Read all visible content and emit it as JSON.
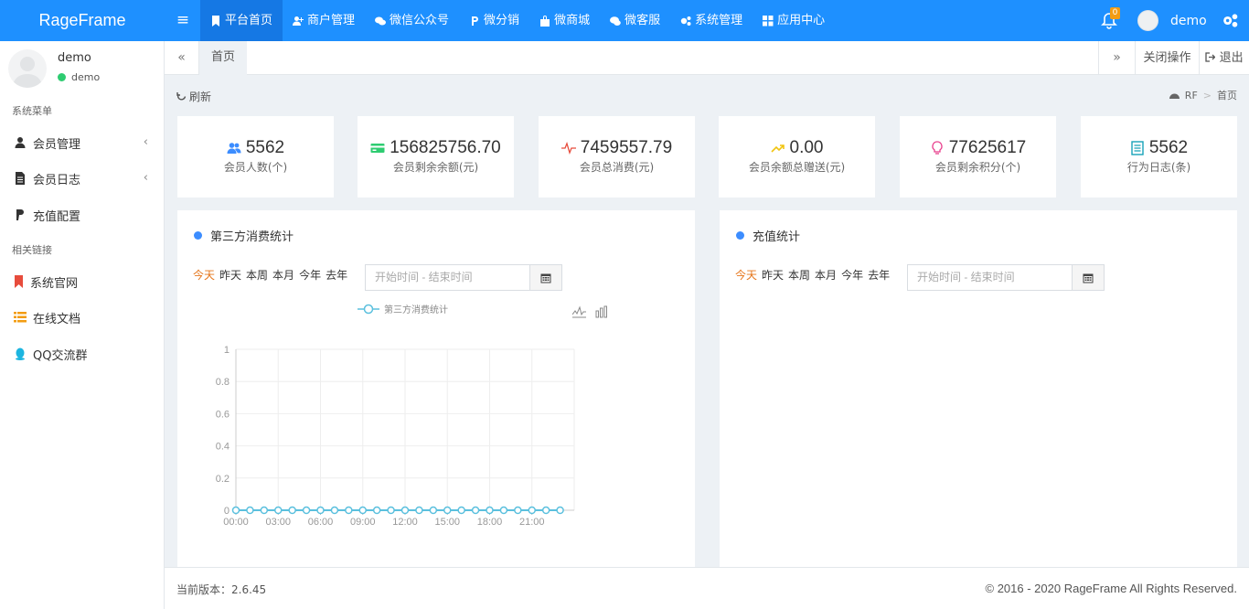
{
  "app": {
    "logo": "RageFrame"
  },
  "topnav": {
    "items": [
      {
        "label": "平台首页",
        "icon": "bookmark-icon"
      },
      {
        "label": "商户管理",
        "icon": "user-plus-icon"
      },
      {
        "label": "微信公众号",
        "icon": "wechat-icon"
      },
      {
        "label": "微分销",
        "icon": "p-icon"
      },
      {
        "label": "微商城",
        "icon": "bag-icon"
      },
      {
        "label": "微客服",
        "icon": "chat-icon"
      },
      {
        "label": "系统管理",
        "icon": "gears-icon"
      },
      {
        "label": "应用中心",
        "icon": "grid-icon"
      }
    ],
    "notification_count": "0",
    "user": "demo"
  },
  "sidebar": {
    "user_name": "demo",
    "user_status": "demo",
    "section1": "系统菜单",
    "items1": [
      {
        "label": "会员管理",
        "icon": "user-icon"
      },
      {
        "label": "会员日志",
        "icon": "file-icon"
      },
      {
        "label": "充值配置",
        "icon": "paypal-icon"
      }
    ],
    "section2": "相关链接",
    "items2": [
      {
        "label": "系统官网",
        "icon": "bookmark-red-icon"
      },
      {
        "label": "在线文档",
        "icon": "list-icon"
      },
      {
        "label": "QQ交流群",
        "icon": "qq-icon"
      }
    ]
  },
  "tabs": {
    "prev": "«",
    "home": "首页",
    "next": "»",
    "close_ops": "关闭操作",
    "logout": "退出"
  },
  "toolbar": {
    "refresh": "刷新"
  },
  "breadcrumb": {
    "root": "RF",
    "sep": ">",
    "current": "首页"
  },
  "stats": [
    {
      "value": "5562",
      "label": "会员人数(个)",
      "icon": "users-icon",
      "color": "#3c8dff"
    },
    {
      "value": "156825756.70",
      "label": "会员剩余余额(元)",
      "icon": "card-icon",
      "color": "#2ecc71"
    },
    {
      "value": "7459557.79",
      "label": "会员总消费(元)",
      "icon": "pulse-icon",
      "color": "#e74c3c"
    },
    {
      "value": "0.00",
      "label": "会员余额总赠送(元)",
      "icon": "trend-icon",
      "color": "#f1c40f"
    },
    {
      "value": "77625617",
      "label": "会员剩余积分(个)",
      "icon": "bulb-icon",
      "color": "#e83e8c"
    },
    {
      "value": "5562",
      "label": "行为日志(条)",
      "icon": "doc-icon",
      "color": "#17a2b8"
    }
  ],
  "panels": {
    "left": {
      "title": "第三方消费统计",
      "periods": [
        "今天",
        "昨天",
        "本周",
        "本月",
        "今年",
        "去年"
      ],
      "date_placeholder": "开始时间 - 结束时间"
    },
    "right": {
      "title": "充值统计",
      "periods": [
        "今天",
        "昨天",
        "本周",
        "本月",
        "今年",
        "去年"
      ],
      "date_placeholder": "开始时间 - 结束时间"
    }
  },
  "chart_data": {
    "type": "line",
    "legend": "第三方消费统计",
    "x": [
      "00:00",
      "01:00",
      "02:00",
      "03:00",
      "04:00",
      "05:00",
      "06:00",
      "07:00",
      "08:00",
      "09:00",
      "10:00",
      "11:00",
      "12:00",
      "13:00",
      "14:00",
      "15:00",
      "16:00",
      "17:00",
      "18:00",
      "19:00",
      "20:00",
      "21:00",
      "22:00",
      "23:00"
    ],
    "x_tick_labels": [
      "00:00",
      "03:00",
      "06:00",
      "09:00",
      "12:00",
      "15:00",
      "18:00",
      "21:00"
    ],
    "series": [
      {
        "name": "第三方消费统计",
        "values": [
          0,
          0,
          0,
          0,
          0,
          0,
          0,
          0,
          0,
          0,
          0,
          0,
          0,
          0,
          0,
          0,
          0,
          0,
          0,
          0,
          0,
          0,
          0,
          0
        ]
      }
    ],
    "y_ticks": [
      "0",
      "0.2",
      "0.4",
      "0.6",
      "0.8",
      "1"
    ],
    "ylim": [
      0,
      1
    ],
    "grid": true,
    "color": "#5bc0de"
  },
  "footer": {
    "version": "当前版本：2.6.45",
    "copyright": "© 2016 - 2020 RageFrame All Rights Reserved."
  }
}
